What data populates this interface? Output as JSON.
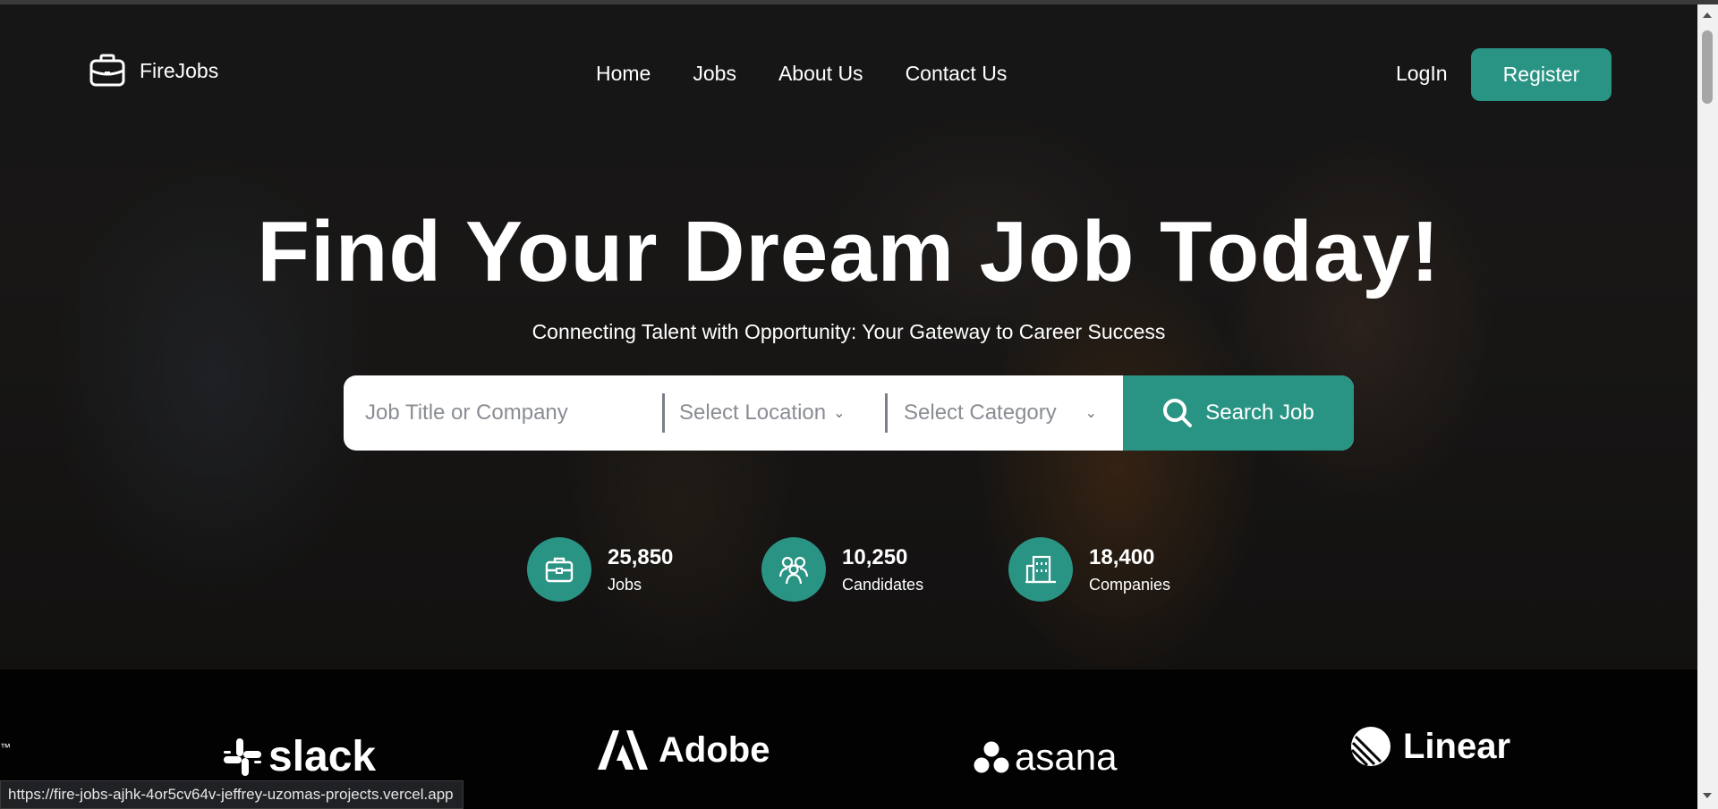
{
  "nav": {
    "brand": "FireJobs",
    "links": [
      "Home",
      "Jobs",
      "About Us",
      "Contact Us"
    ],
    "login": "LogIn",
    "register": "Register"
  },
  "hero": {
    "title": "Find Your Dream Job Today!",
    "subtitle": "Connecting Talent with Opportunity: Your Gateway to Career Success"
  },
  "search": {
    "title_placeholder": "Job Title or Company",
    "location_placeholder": "Select Location",
    "category_placeholder": "Select Category",
    "button": "Search Job"
  },
  "stats": [
    {
      "value": "25,850",
      "label": "Jobs",
      "icon": "briefcase-icon"
    },
    {
      "value": "10,250",
      "label": "Candidates",
      "icon": "people-icon"
    },
    {
      "value": "18,400",
      "label": "Companies",
      "icon": "building-icon"
    }
  ],
  "brands": [
    "slack",
    "Adobe",
    "asana",
    "Linear"
  ],
  "status_url": "https://fire-jobs-ajhk-4or5cv64v-jeffrey-uzomas-projects.vercel.app",
  "colors": {
    "accent": "#2a9484",
    "text": "#ffffff",
    "brand_strip": "#020202"
  }
}
